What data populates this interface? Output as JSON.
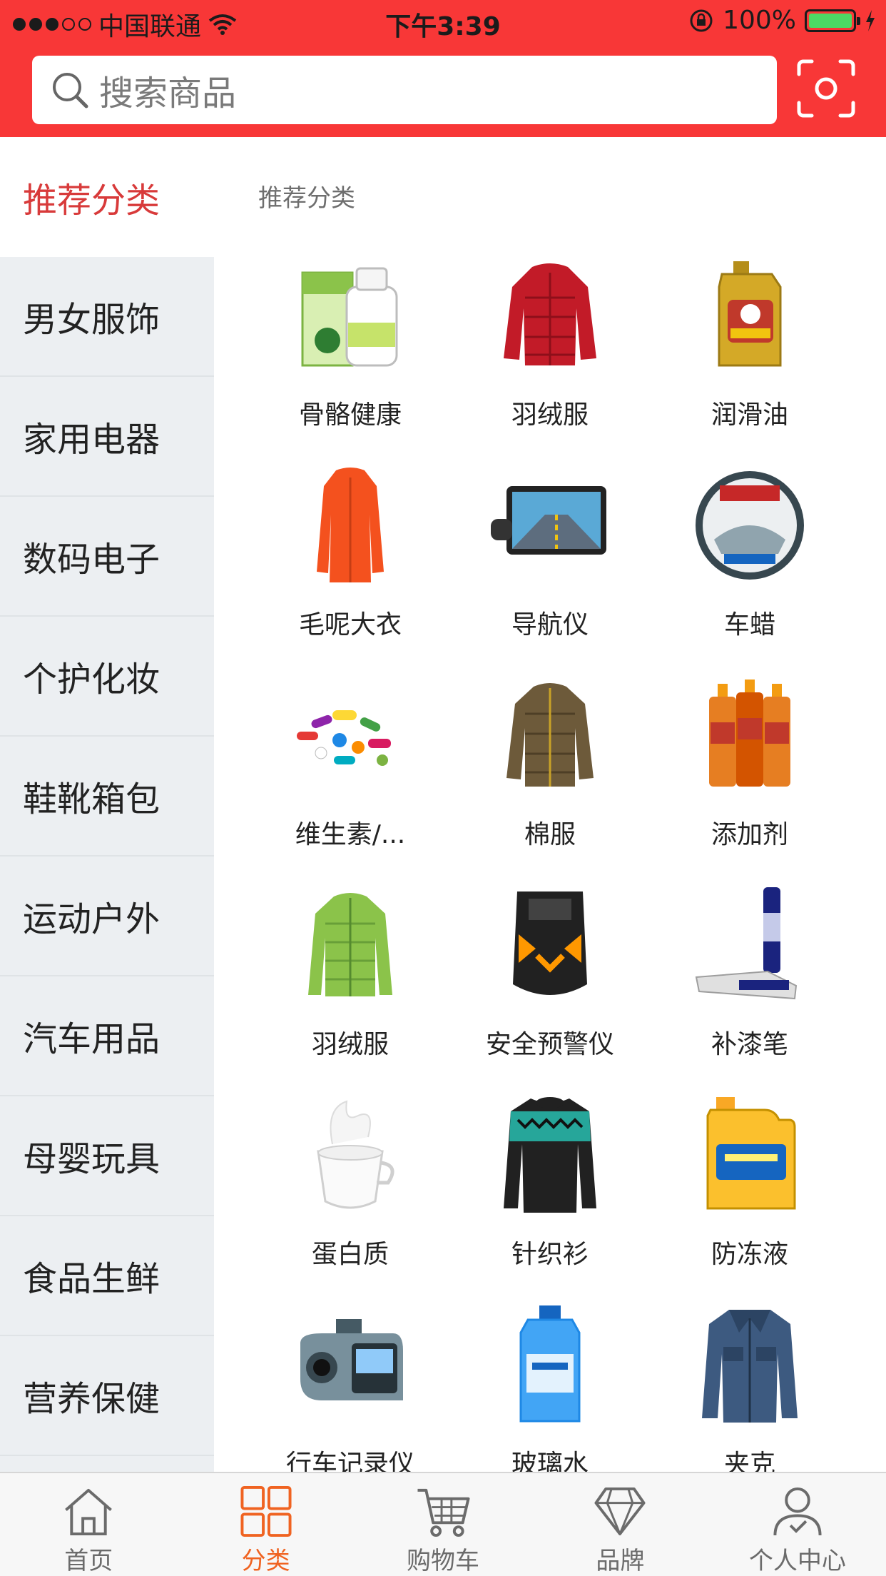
{
  "status_bar": {
    "carrier": "中国联通",
    "time": "下午3:39",
    "battery": "100%",
    "signal_bars_filled": 3,
    "signal_bars_total": 5
  },
  "search": {
    "placeholder": "搜索商品"
  },
  "sidebar": {
    "items": [
      {
        "label": "推荐分类",
        "active": true
      },
      {
        "label": "男女服饰",
        "active": false
      },
      {
        "label": "家用电器",
        "active": false
      },
      {
        "label": "数码电子",
        "active": false
      },
      {
        "label": "个护化妆",
        "active": false
      },
      {
        "label": "鞋靴箱包",
        "active": false
      },
      {
        "label": "运动户外",
        "active": false
      },
      {
        "label": "汽车用品",
        "active": false
      },
      {
        "label": "母婴玩具",
        "active": false
      },
      {
        "label": "食品生鲜",
        "active": false
      },
      {
        "label": "营养保健",
        "active": false
      }
    ]
  },
  "main": {
    "section_title": "推荐分类",
    "categories": [
      {
        "label": "骨骼健康",
        "icon": "supplement-bottle-icon"
      },
      {
        "label": "羽绒服",
        "icon": "red-down-jacket-icon"
      },
      {
        "label": "润滑油",
        "icon": "motor-oil-icon"
      },
      {
        "label": "毛呢大衣",
        "icon": "orange-coat-icon"
      },
      {
        "label": "导航仪",
        "icon": "gps-navigator-icon"
      },
      {
        "label": "车蜡",
        "icon": "car-wax-icon"
      },
      {
        "label": "维生素/...",
        "icon": "vitamin-pills-icon"
      },
      {
        "label": "棉服",
        "icon": "brown-padded-jacket-icon"
      },
      {
        "label": "添加剂",
        "icon": "fuel-additive-icon"
      },
      {
        "label": "羽绒服",
        "icon": "green-down-jacket-icon"
      },
      {
        "label": "安全预警仪",
        "icon": "radar-detector-icon"
      },
      {
        "label": "补漆笔",
        "icon": "touch-up-pen-icon"
      },
      {
        "label": "蛋白质",
        "icon": "milk-cup-icon"
      },
      {
        "label": "针织衫",
        "icon": "knit-sweater-icon"
      },
      {
        "label": "防冻液",
        "icon": "antifreeze-jug-icon"
      },
      {
        "label": "行车记录仪",
        "icon": "dash-cam-icon"
      },
      {
        "label": "玻璃水",
        "icon": "washer-fluid-icon"
      },
      {
        "label": "夹克",
        "icon": "denim-jacket-icon"
      }
    ]
  },
  "tabbar": {
    "items": [
      {
        "label": "首页",
        "icon": "home-icon",
        "active": false
      },
      {
        "label": "分类",
        "icon": "category-grid-icon",
        "active": true
      },
      {
        "label": "购物车",
        "icon": "cart-icon",
        "active": false
      },
      {
        "label": "品牌",
        "icon": "diamond-icon",
        "active": false
      },
      {
        "label": "个人中心",
        "icon": "user-icon",
        "active": false
      }
    ]
  },
  "colors": {
    "header": "#f83737",
    "active_sidebar": "#d83a3a",
    "active_tab": "#f06321",
    "sidebar_bg": "#eceff2"
  }
}
